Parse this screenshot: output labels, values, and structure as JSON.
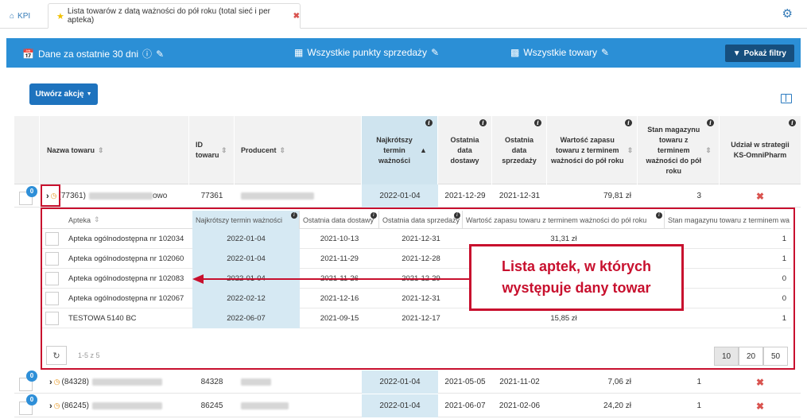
{
  "tabs": {
    "kpi_label": "KPI",
    "active_label": "Lista towarów z datą ważności do pół roku (total sieć i per apteka)"
  },
  "filter_bar": {
    "period": "Dane za ostatnie 30 dni",
    "points": "Wszystkie punkty sprzedaży",
    "products": "Wszystkie towary",
    "show_filters": "Pokaż filtry"
  },
  "action_button": "Utwórz akcję",
  "main_table": {
    "headers": {
      "name": "Nazwa towaru",
      "id": "ID towaru",
      "producer": "Producent",
      "shortest": "Najkrótszy termin ważności",
      "last_delivery": "Ostatnia data dostawy",
      "last_sale": "Ostatnia data sprzedaży",
      "stock_value": "Wartość zapasu towaru z terminem ważności do pół roku",
      "stock_qty": "Stan magazynu towaru z terminem ważności do pół roku",
      "strategy": "Udział w strategii KS-OmniPharm"
    },
    "rows": [
      {
        "badge": "0",
        "code": "(77361)",
        "suffix": "owo",
        "id": "77361",
        "shortest": "2022-01-04",
        "delivery": "2021-12-29",
        "sale": "2021-12-31",
        "value": "79,81 zł",
        "qty": "3"
      },
      {
        "badge": "0",
        "code": "(84328)",
        "suffix": "",
        "id": "84328",
        "shortest": "2022-01-04",
        "delivery": "2021-05-05",
        "sale": "2021-11-02",
        "value": "7,06 zł",
        "qty": "1"
      },
      {
        "badge": "0",
        "code": "(86245)",
        "suffix": "",
        "id": "86245",
        "shortest": "2022-01-04",
        "delivery": "2021-06-07",
        "sale": "2021-02-06",
        "value": "24,20 zł",
        "qty": "1"
      }
    ]
  },
  "sub_table": {
    "headers": {
      "pharmacy": "Apteka",
      "shortest": "Najkrótszy termin ważności",
      "delivery": "Ostatnia data dostawy",
      "sale": "Ostatnia data sprzedaży",
      "value": "Wartość zapasu towaru z terminem ważności do pół roku",
      "qty": "Stan magazynu towaru z terminem wa"
    },
    "rows": [
      {
        "name": "Apteka ogólnodostępna nr 102034",
        "shortest": "2022-01-04",
        "delivery": "2021-10-13",
        "sale": "2021-12-31",
        "value": "31,31 zł",
        "qty": "1"
      },
      {
        "name": "Apteka ogólnodostępna nr 102060",
        "shortest": "2022-01-04",
        "delivery": "2021-11-29",
        "sale": "2021-12-28",
        "value": "",
        "qty": "1"
      },
      {
        "name": "Apteka ogólnodostępna nr 102083",
        "shortest": "2022-01-04",
        "delivery": "2021-11-26",
        "sale": "2021-12-29",
        "value": "",
        "qty": "0"
      },
      {
        "name": "Apteka ogólnodostępna nr 102067",
        "shortest": "2022-02-12",
        "delivery": "2021-12-16",
        "sale": "2021-12-31",
        "value": "",
        "qty": "0"
      },
      {
        "name": "TESTOWA 5140 BC",
        "shortest": "2022-06-07",
        "delivery": "2021-09-15",
        "sale": "2021-12-17",
        "value": "15,85 zł",
        "qty": "1"
      }
    ],
    "pagination": {
      "count": "1-5 z 5",
      "sizes": [
        "10",
        "20",
        "50"
      ]
    }
  },
  "callout": {
    "line1": "Lista aptek, w których",
    "line2": "występuje dany towar"
  },
  "colors": {
    "accent": "#2b8fd6",
    "annotation": "#c8102e",
    "highlight": "#d6e9f3"
  }
}
